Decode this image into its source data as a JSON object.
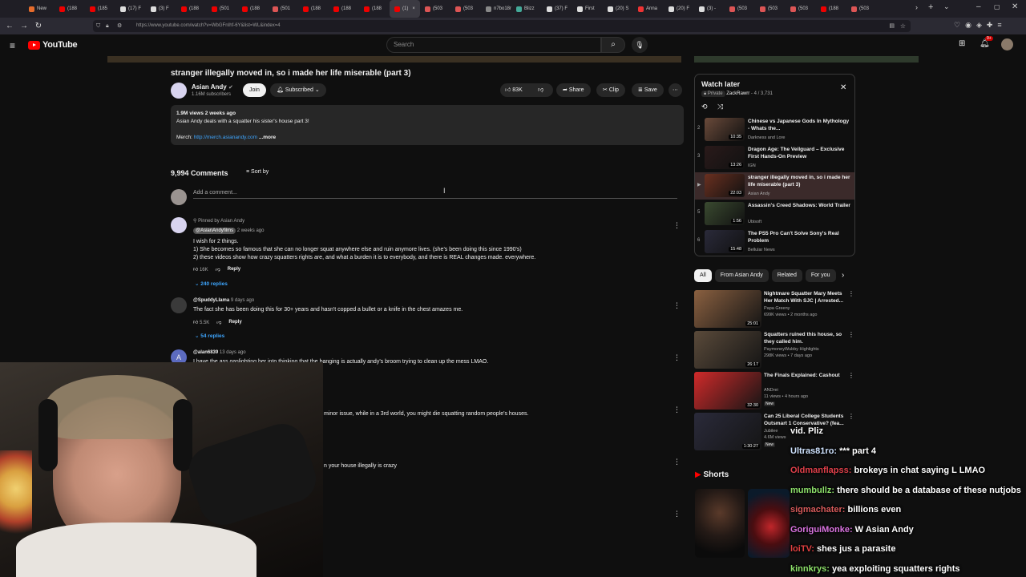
{
  "browser": {
    "tabs": [
      {
        "label": "New",
        "color": "#e66c2c"
      },
      {
        "label": "(188",
        "color": "#e00"
      },
      {
        "label": "(185",
        "color": "#e00"
      },
      {
        "label": "(17) F",
        "color": "#ddd"
      },
      {
        "label": "(3) F",
        "color": "#ddd"
      },
      {
        "label": "(188",
        "color": "#e00"
      },
      {
        "label": "(501",
        "color": "#e00"
      },
      {
        "label": "(188",
        "color": "#e00"
      },
      {
        "label": "(501",
        "color": "#d55"
      },
      {
        "label": "(188",
        "color": "#e00"
      },
      {
        "label": "(188",
        "color": "#e00"
      },
      {
        "label": "(188",
        "color": "#e00"
      },
      {
        "label": "(1)",
        "color": "#e00",
        "active": true
      },
      {
        "label": "(503",
        "color": "#d55"
      },
      {
        "label": "(503",
        "color": "#d55"
      },
      {
        "label": "n7bo18m",
        "color": "#888"
      },
      {
        "label": "Blizz",
        "color": "#4a9"
      },
      {
        "label": "(37) F",
        "color": "#ddd"
      },
      {
        "label": "First",
        "color": "#ddd"
      },
      {
        "label": "(20) S",
        "color": "#ddd"
      },
      {
        "label": "Anna",
        "color": "#e33"
      },
      {
        "label": "(20) F",
        "color": "#ddd"
      },
      {
        "label": "(3) -",
        "color": "#ddd"
      },
      {
        "label": "(503",
        "color": "#d55"
      },
      {
        "label": "(503",
        "color": "#d55"
      },
      {
        "label": "(503",
        "color": "#d55"
      },
      {
        "label": "(188",
        "color": "#e00"
      },
      {
        "label": "(503",
        "color": "#d55"
      }
    ],
    "url": "https://www.youtube.com/watch?v=WbGFnIhf-6Y&list=WL&index=4",
    "notification_badge": "9+"
  },
  "youtube": {
    "logo_text": "YouTube",
    "search_placeholder": "Search"
  },
  "video": {
    "title": "stranger illegally moved in, so i made her life miserable (part 3)",
    "channel": "Asian Andy",
    "subscribers": "1.16M subscribers",
    "join_label": "Join",
    "subscribed_label": "Subscribed",
    "likes": "83K",
    "share_label": "Share",
    "clip_label": "Clip",
    "save_label": "Save",
    "description": {
      "stats": "1.9M views  2 weeks ago",
      "line1": "Asian Andy deals with a squatter his sister's house part 3!",
      "merch_label": "Merch: ",
      "merch_link": "http://merch.asianandy.com",
      "more_label": "...more"
    }
  },
  "comments": {
    "count_label": "9,994 Comments",
    "sort_label": "Sort by",
    "add_placeholder": "Add a comment...",
    "items": [
      {
        "pinned": "Pinned by Asian Andy",
        "author": "@AsianAndyfilms",
        "time": "2 weeks ago",
        "lines": [
          "I wish for 2 things.",
          "1) She becomes so famous that she can no longer squat anywhere else and ruin anymore lives. (she's been doing this since 1990's)",
          "2) these videos show how crazy squatters rights are, and what a burden it is to everybody, and there is REAL changes made. everywhere."
        ],
        "likes": "16K",
        "reply_label": "Reply",
        "replies": "240 replies"
      },
      {
        "author": "@SpuddyLlama",
        "time": "9 days ago",
        "lines": [
          "The fact she has been doing this for 30+ years and hasn't copped a bullet or a knife in the chest amazes me."
        ],
        "likes": "5.5K",
        "reply_label": "Reply",
        "replies": "54 replies"
      },
      {
        "author": "@alan6839",
        "time": "13 days ago",
        "lines": [
          "I have the ass gaslighting her into thinking that the banging is actually andy's broom trying to clean up the mess LMAO."
        ]
      }
    ],
    "partial_text": [
      "minor issue, while in a 3rd world, you might die squatting random people's houses.",
      "n your house illegally is crazy"
    ]
  },
  "watch_later": {
    "title": "Watch later",
    "privacy": "Private",
    "owner": "ZackRawrr",
    "position": "4 / 3,731",
    "items": [
      {
        "index": "2",
        "title": "Chinese vs Japanese Gods In Mythology - Whats the...",
        "channel": "Darkness and Lore",
        "duration": "10:35"
      },
      {
        "index": "3",
        "title": "Dragon Age: The Veilguard – Exclusive First Hands-On Preview",
        "channel": "IGN",
        "duration": "13:26"
      },
      {
        "index": "▶",
        "title": "stranger illegally moved in, so i made her life miserable (part 3)",
        "channel": "Asian Andy",
        "duration": "22:03",
        "current": true
      },
      {
        "index": "5",
        "title": "Assassin's Creed Shadows: World Trailer",
        "channel": "Ubisoft",
        "duration": "1:56"
      },
      {
        "index": "6",
        "title": "The PS5 Pro Can't Solve Sony's Real Problem",
        "channel": "Bellular News",
        "duration": "15:48"
      }
    ]
  },
  "chips": [
    "All",
    "From Asian Andy",
    "Related",
    "For you"
  ],
  "recommendations": [
    {
      "title": "Nightmare Squatter Mary Meets Her Match With SJC | Arrested...",
      "channel": "Papa Greeny",
      "meta": "699K views • 2 months ago",
      "duration": "25:01"
    },
    {
      "title": "Squatters ruined this house, so they called him.",
      "channel": "PaymoneyWubby Highlights",
      "meta": "298K views • 7 days ago",
      "duration": "26:17"
    },
    {
      "title": "The Finals Explained: Cashout",
      "channel": "ANDrei",
      "meta": "11 views • 4 hours ago",
      "badge": "New",
      "duration": "32:30"
    },
    {
      "title": "Can 25 Liberal College Students Outsmart 1 Conservative? (fea...",
      "channel": "Jubilee",
      "meta": "4.6M views",
      "badge": "New",
      "duration": "1:30:27"
    }
  ],
  "shorts_label": "Shorts",
  "chat": [
    {
      "user": "",
      "msg": "vid. Pliz",
      "color": "#ffffff"
    },
    {
      "user": "Ultras81ro:",
      "msg": "*** part 4",
      "color": "#cfe3ff"
    },
    {
      "user": "Oldmanflapss:",
      "msg": "brokeys in chat saying L LMAO",
      "color": "#e0404a"
    },
    {
      "user": "mumbullz:",
      "msg": "there should be a database of these nutjobs",
      "color": "#8ee26b"
    },
    {
      "user": "sigmachater:",
      "msg": "billions even",
      "color": "#d65a5a"
    },
    {
      "user": "GoriguiMonke:",
      "msg": "W Asian Andy",
      "color": "#d973e0"
    },
    {
      "user": "loiTV:",
      "msg": "shes jus a parasite",
      "color": "#e04040"
    },
    {
      "user": "kinnkrys:",
      "msg": "yea exploiting squatters rights",
      "color": "#8ee26b"
    }
  ]
}
